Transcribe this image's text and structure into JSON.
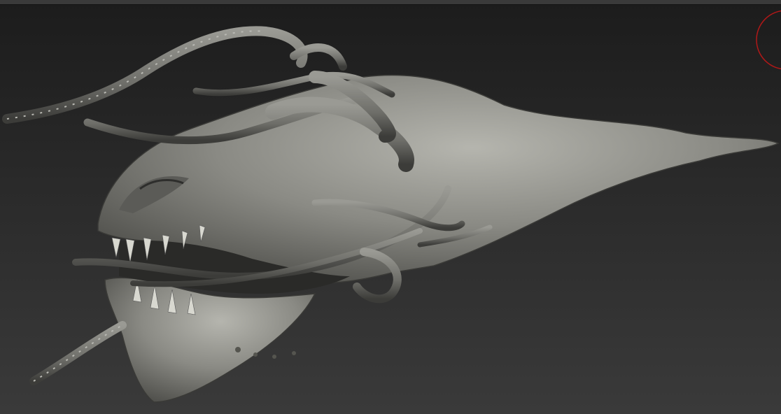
{
  "viewport": {
    "background_top": "#1c1c1c",
    "background_bottom": "#3a3a3a"
  },
  "model": {
    "material_color": "#8a8a85",
    "shadow_color": "#3e3e3b",
    "highlight_color": "#b9b9b3"
  },
  "gizmo": {
    "ring_color": "#b01818"
  }
}
